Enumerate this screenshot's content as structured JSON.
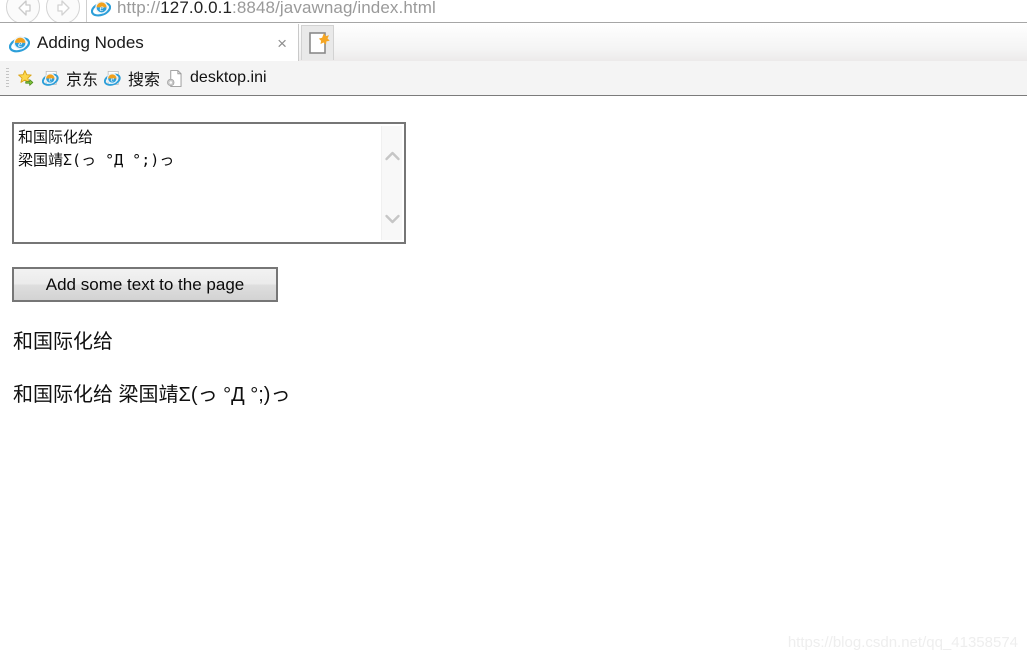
{
  "browser": {
    "nav": {
      "back_label": "Back",
      "forward_label": "Forward"
    },
    "address": {
      "url_scheme": "http://",
      "url_host": "127.0.0.1",
      "url_rest": ":8848/javawnag/index.html",
      "full_url": "http://127.0.0.1:8848/javawnag/index.html",
      "icon": "ie-logo-icon"
    },
    "tab": {
      "title": "Adding Nodes",
      "favicon": "ie-logo-icon",
      "close_label": "×",
      "newtab_label": "New tab",
      "newtab_icon": "new-tab-page-icon"
    },
    "favorites": [
      {
        "label": "",
        "icon": "favorites-star-icon"
      },
      {
        "label": "京东",
        "icon": "ie-logo-icon"
      },
      {
        "label": "搜索",
        "icon": "ie-logo-icon"
      },
      {
        "label": "desktop.ini",
        "icon": "ini-file-icon"
      }
    ]
  },
  "page": {
    "textarea": {
      "value": "和国际化给\n梁国靖Σ(っ °Д °;)っ",
      "scroll_up_label": "Scroll up",
      "scroll_down_label": "Scroll down"
    },
    "button": {
      "label": "Add some text to the page"
    },
    "paragraphs": [
      "和国际化给",
      "和国际化给 梁国靖Σ(っ °Д °;)っ"
    ],
    "watermark": "https://blog.csdn.net/qq_41358574"
  }
}
